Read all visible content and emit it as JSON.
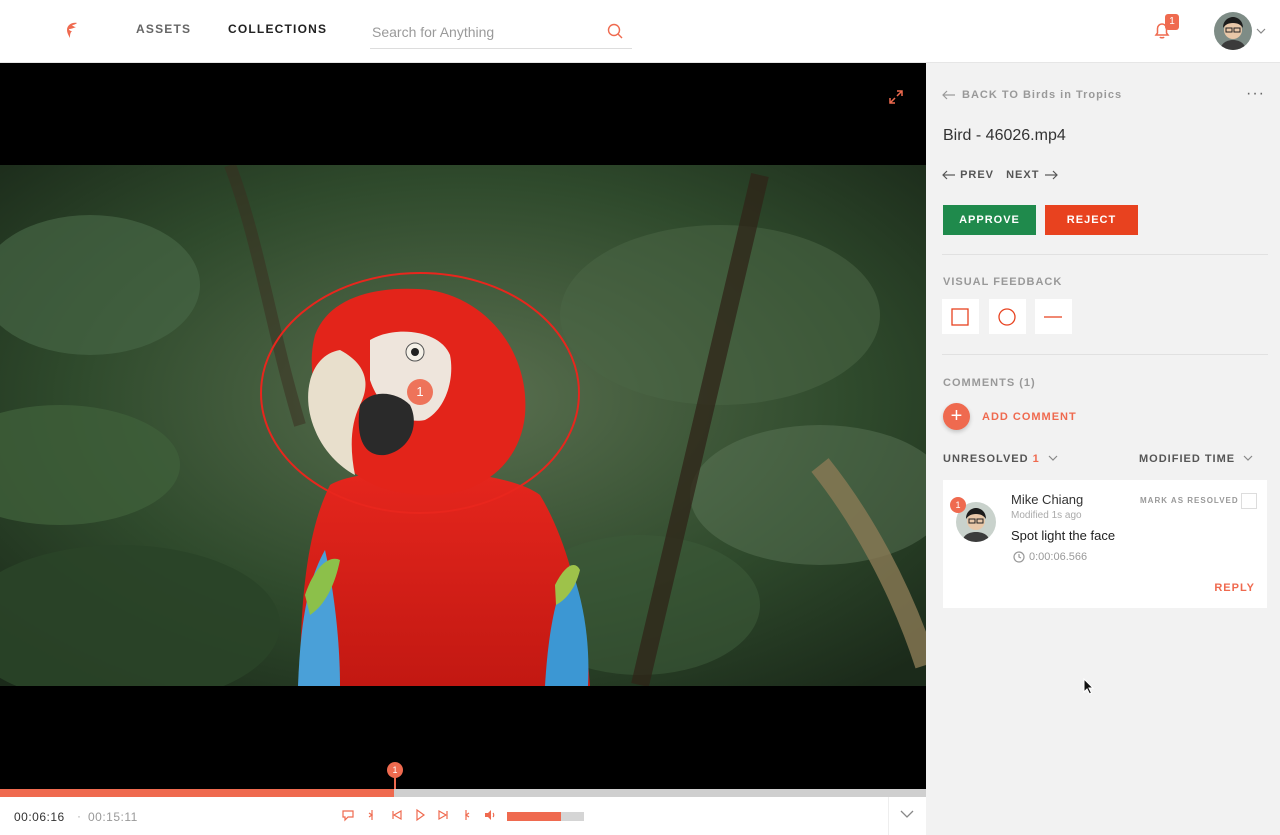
{
  "header": {
    "nav": {
      "assets": "ASSETS",
      "collections": "COLLECTIONS"
    },
    "search_placeholder": "Search for Anything",
    "notification_count": "1",
    "icons": [
      "logo-icon",
      "search-icon",
      "bell-icon",
      "chevron-down-icon"
    ]
  },
  "player": {
    "annotation_number": "1",
    "timeline_marker": "1",
    "current_time": "00:06:16",
    "separator": "·",
    "total_time": "00:15:11",
    "progress_fraction": 0.426,
    "volume_fraction": 0.7
  },
  "panel": {
    "back_label": "BACK TO Birds in Tropics",
    "more": "···",
    "file_title": "Bird - 46026.mp4",
    "prev": "PREV",
    "next": "NEXT",
    "approve": "APPROVE",
    "reject": "REJECT",
    "visual_feedback": "VISUAL FEEDBACK",
    "comments_label": "COMMENTS (1)",
    "add_comment": "ADD COMMENT",
    "filter_unresolved": "UNRESOLVED",
    "filter_unresolved_count": "1",
    "sort_label": "MODIFIED TIME"
  },
  "comment": {
    "badge": "1",
    "author": "Mike Chiang",
    "modified": "Modified 1s ago",
    "text": "Spot light the face",
    "timecode": "0:00:06.566",
    "mark_resolved": "MARK AS RESOLVED",
    "reply": "REPLY"
  },
  "colors": {
    "accent": "#ef6a4f",
    "approve": "#1f8a4c",
    "reject": "#e8421f"
  }
}
